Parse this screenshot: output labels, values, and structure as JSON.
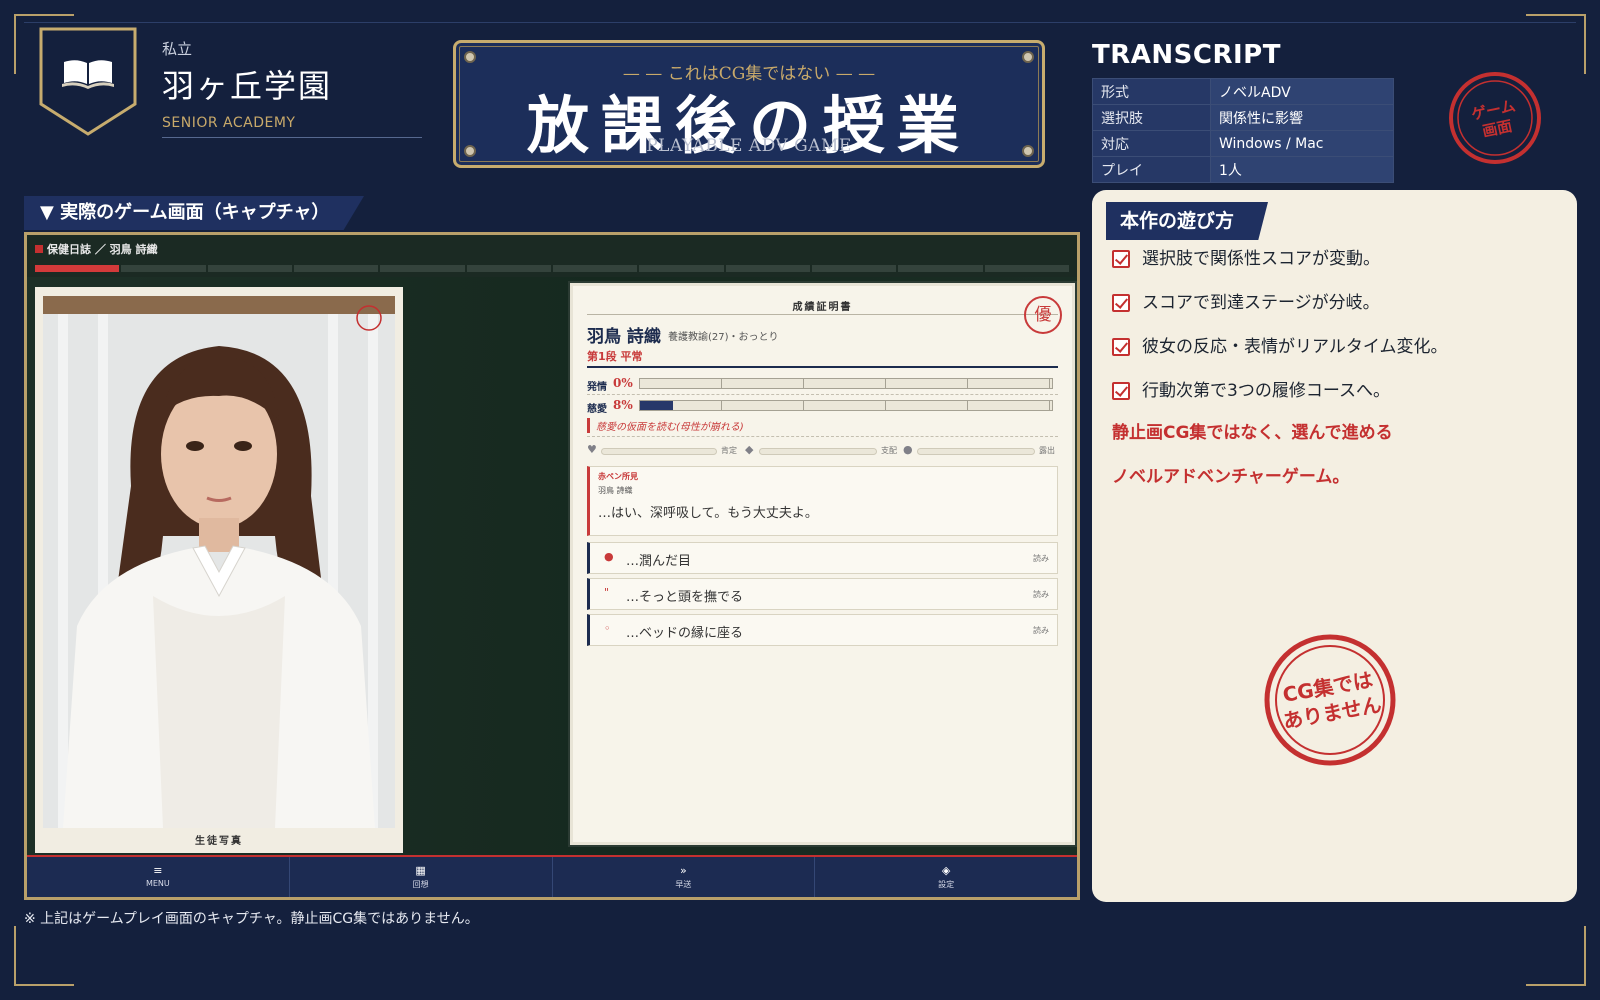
{
  "school": {
    "prefix": "私立",
    "name": "羽ヶ丘学園",
    "english": "SENIOR ACADEMY"
  },
  "title_plate": {
    "subtitle": "— — これはCG集ではない — —",
    "main": "放課後の授業",
    "english": "PLAYABLE ADV GAME"
  },
  "transcript": {
    "heading": "TRANSCRIPT",
    "rows": [
      {
        "key": "形式",
        "value": "ノベルADV"
      },
      {
        "key": "選択肢",
        "value": "関係性に影響"
      },
      {
        "key": "対応",
        "value": "Windows / Mac"
      },
      {
        "key": "プレイ",
        "value": "1人"
      }
    ]
  },
  "stamp_top": {
    "line1": "ゲーム",
    "line2": "画面"
  },
  "section_header": "▼ 実際のゲーム画面（キャプチャ）",
  "game": {
    "breadcrumb": "保健日誌 ／ 羽鳥 詩織",
    "progress": {
      "segments": 12,
      "filled": 1
    },
    "photo_caption": "生徒写真",
    "report": {
      "title": "成績証明書",
      "seal": "優",
      "name": "羽鳥 詩織",
      "role": "養護教諭(27)・おっとり",
      "stage": "第1段 平常",
      "meters": [
        {
          "label": "発情",
          "value_text": "0%",
          "value": 0
        },
        {
          "label": "慈愛",
          "value_text": "8%",
          "value": 8
        }
      ],
      "note": "慈愛の仮面を読む(母性が崩れる)",
      "sliders": [
        {
          "glyph": "♥",
          "label": "肯定"
        },
        {
          "glyph": "◆",
          "label": "支配"
        },
        {
          "glyph": "●",
          "label": "露出"
        }
      ],
      "message": {
        "tag": "赤ペン所見",
        "speaker": "羽鳥 詩織",
        "text": "…はい、深呼吸して。もう大丈夫よ。"
      },
      "choices": [
        {
          "mark": "●",
          "text": "…潤んだ目",
          "hint": "読み"
        },
        {
          "mark": "\"",
          "text": "…そっと頭を撫でる",
          "hint": "読み"
        },
        {
          "mark": "◦",
          "text": "…ベッドの縁に座る",
          "hint": "読み"
        }
      ]
    },
    "nav": [
      {
        "icon": "≡",
        "label": "MENU"
      },
      {
        "icon": "▦",
        "label": "回想"
      },
      {
        "icon": "»",
        "label": "早送"
      },
      {
        "icon": "◈",
        "label": "設定"
      }
    ]
  },
  "footnote": "※ 上記はゲームプレイ画面のキャプチャ。静止画CG集ではありません。",
  "howto": {
    "heading": "本作の遊び方",
    "checks": [
      "選択肢で関係性スコアが変動。",
      "スコアで到達ステージが分岐。",
      "彼女の反応・表情がリアルタイム変化。",
      "行動次第で3つの履修コースへ。"
    ],
    "red_lines": [
      "静止画CG集ではなく、選んで進める",
      "ノベルアドベンチャーゲーム。"
    ],
    "stamp": {
      "line1": "CG集では",
      "line2": "ありません"
    }
  },
  "colors": {
    "background": "#14203d",
    "gold": "#c7ac6e",
    "accent_red": "#c43030",
    "navy": "#1f3060",
    "panel": "#f4efe2"
  }
}
